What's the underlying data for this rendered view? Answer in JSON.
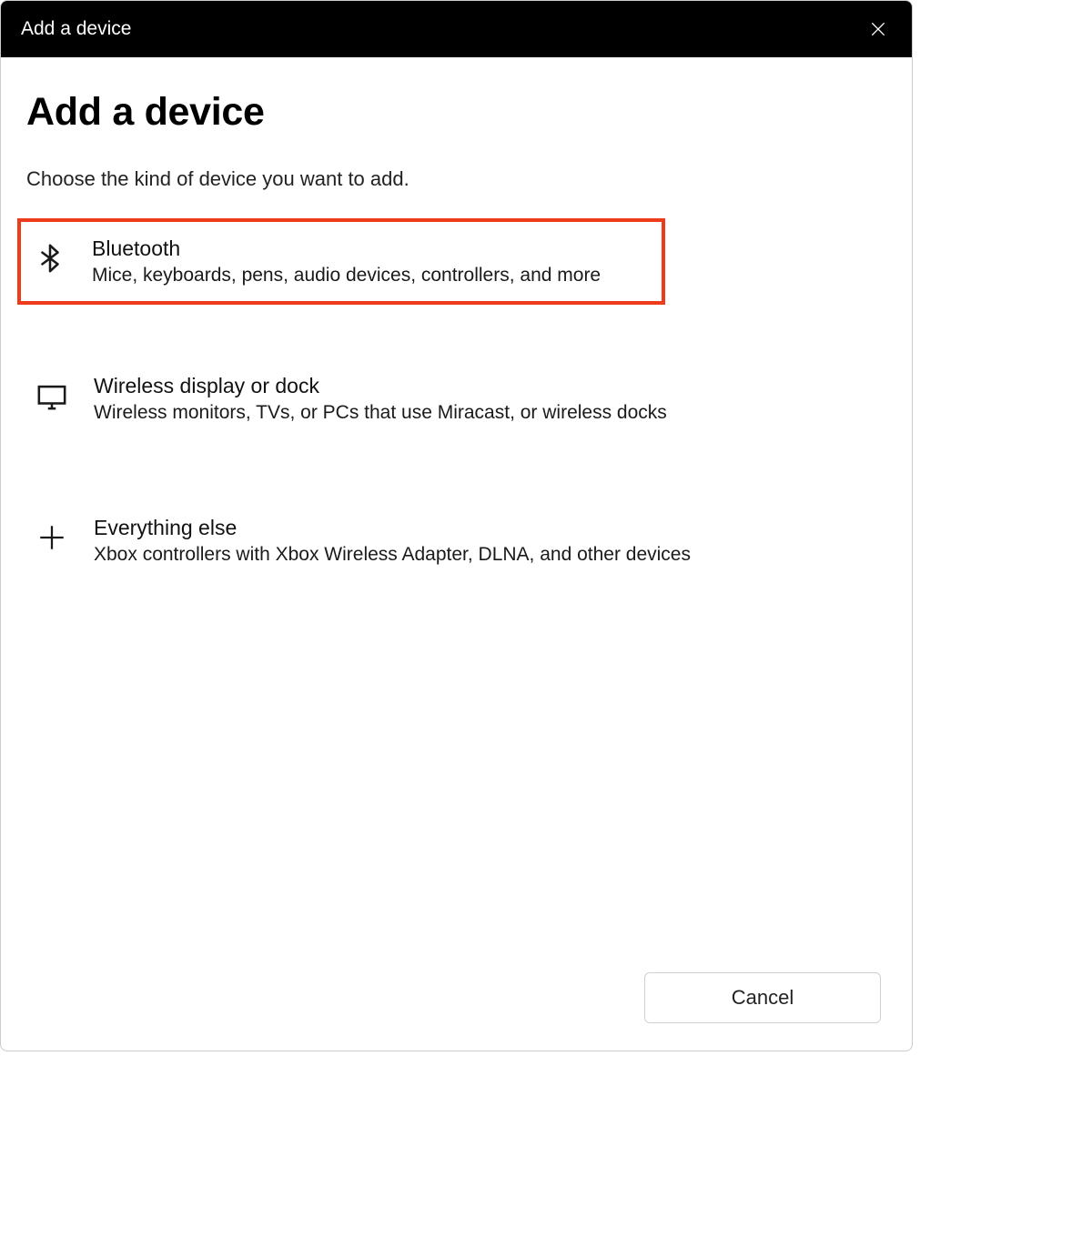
{
  "titlebar": {
    "title": "Add a device"
  },
  "header": {
    "title": "Add a device",
    "subtitle": "Choose the kind of device you want to add."
  },
  "options": [
    {
      "id": "bluetooth",
      "title": "Bluetooth",
      "description": "Mice, keyboards, pens, audio devices, controllers, and more",
      "highlighted": true,
      "icon": "bluetooth-icon"
    },
    {
      "id": "wireless-display",
      "title": "Wireless display or dock",
      "description": "Wireless monitors, TVs, or PCs that use Miracast, or wireless docks",
      "highlighted": false,
      "icon": "monitor-icon"
    },
    {
      "id": "everything-else",
      "title": "Everything else",
      "description": "Xbox controllers with Xbox Wireless Adapter, DLNA, and other devices",
      "highlighted": false,
      "icon": "plus-icon"
    }
  ],
  "footer": {
    "cancel_label": "Cancel"
  }
}
